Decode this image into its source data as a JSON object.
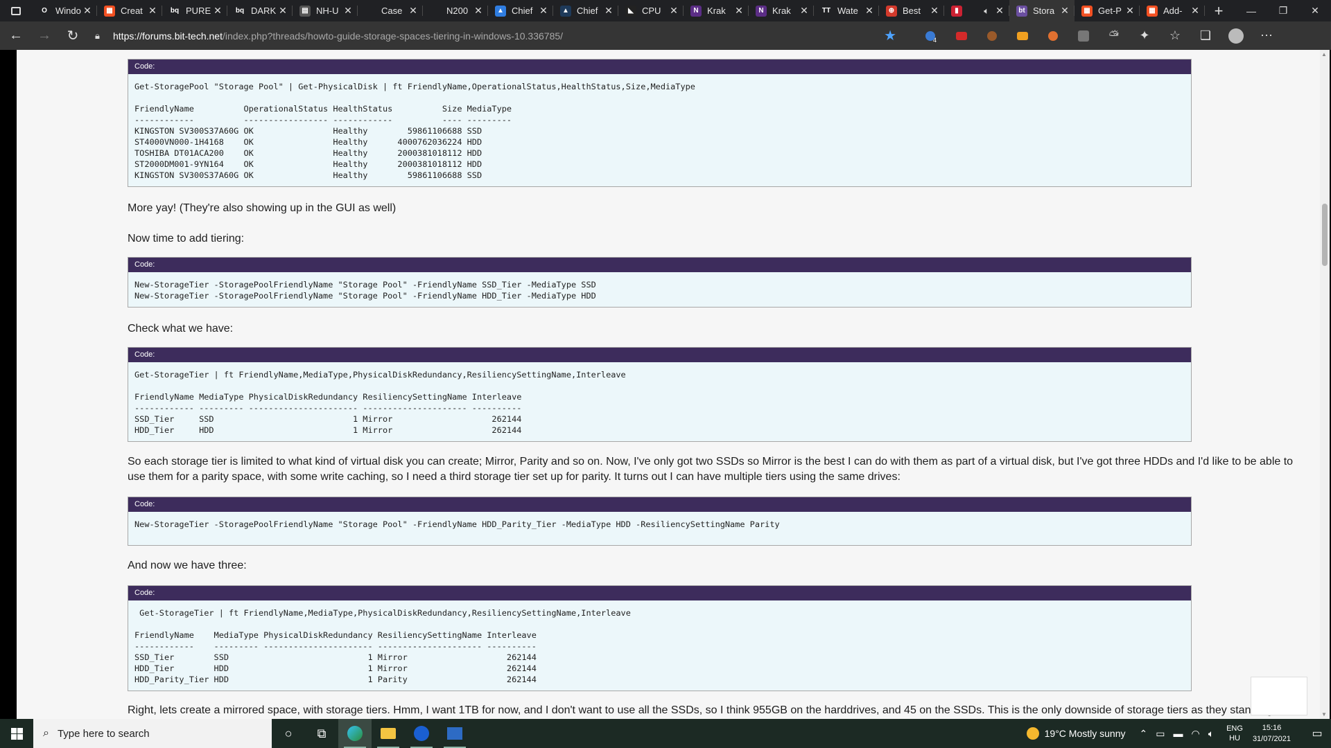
{
  "tabs": [
    {
      "title": "Windo",
      "color": "#202124",
      "glyph": "O"
    },
    {
      "title": "Creat",
      "color": "#f25022",
      "glyph": "▦"
    },
    {
      "title": "PURE",
      "color": "#202124",
      "glyph": "bq"
    },
    {
      "title": "DARK",
      "color": "#202124",
      "glyph": "bq"
    },
    {
      "title": "NH-U",
      "color": "#555555",
      "glyph": "▤"
    },
    {
      "title": "Case",
      "color": "#202124",
      "glyph": ""
    },
    {
      "title": "N200",
      "color": "#202124",
      "glyph": ""
    },
    {
      "title": "Chief",
      "color": "#2f7de1",
      "glyph": "▲"
    },
    {
      "title": "Chief",
      "color": "#1e3a5a",
      "glyph": "▲"
    },
    {
      "title": "CPU",
      "color": "#222222",
      "glyph": "◣"
    },
    {
      "title": "Krak",
      "color": "#5b2d86",
      "glyph": "N"
    },
    {
      "title": "Krak",
      "color": "#5b2d86",
      "glyph": "N"
    },
    {
      "title": "Wate",
      "color": "#202124",
      "glyph": "TT"
    },
    {
      "title": "Best",
      "color": "#d33a2c",
      "glyph": "⊕"
    },
    {
      "title": "",
      "color": "#c23",
      "glyph": "▮"
    },
    {
      "title": "Stora",
      "color": "#6b4fa0",
      "glyph": "bt"
    },
    {
      "title": "Get-P",
      "color": "#f25022",
      "glyph": "▦"
    },
    {
      "title": "Add-",
      "color": "#f25022",
      "glyph": "▦"
    }
  ],
  "nav": {
    "url_host": "https://forums.bit-tech.net",
    "url_path": "/index.php?threads/howto-guide-storage-spaces-tiering-in-windows-10.336785/",
    "ext_badge": "4"
  },
  "content": {
    "code_label": "Code:",
    "block1": "Get-StoragePool \"Storage Pool\" | Get-PhysicalDisk | ft FriendlyName,OperationalStatus,HealthStatus,Size,MediaType\n\nFriendlyName          OperationalStatus HealthStatus          Size MediaType\n------------          ----------------- ------------          ---- ---------\nKINGSTON SV300S37A60G OK                Healthy        59861106688 SSD\nST4000VN000-1H4168    OK                Healthy      4000762036224 HDD\nTOSHIBA DT01ACA200    OK                Healthy      2000381018112 HDD\nST2000DM001-9YN164    OK                Healthy      2000381018112 HDD\nKINGSTON SV300S37A60G OK                Healthy        59861106688 SSD",
    "p1": "More yay! (They're also showing up in the GUI as well)",
    "p2": "Now time to add tiering:",
    "block2": "New-StorageTier -StoragePoolFriendlyName \"Storage Pool\" -FriendlyName SSD_Tier -MediaType SSD\nNew-StorageTier -StoragePoolFriendlyName \"Storage Pool\" -FriendlyName HDD_Tier -MediaType HDD",
    "p3": "Check what we have:",
    "block3": "Get-StorageTier | ft FriendlyName,MediaType,PhysicalDiskRedundancy,ResiliencySettingName,Interleave\n\nFriendlyName MediaType PhysicalDiskRedundancy ResiliencySettingName Interleave\n------------ --------- ---------------------- --------------------- ----------\nSSD_Tier     SSD                            1 Mirror                    262144\nHDD_Tier     HDD                            1 Mirror                    262144",
    "p4": "So each storage tier is limited to what kind of virtual disk you can create; Mirror, Parity and so on. Now, I've only got two SSDs so Mirror is the best I can do with them as part of a virtual disk, but I've got three HDDs and I'd like to be able to use them for a parity space, with some write caching, so I need a third storage tier set up for parity. It turns out I can have multiple tiers using the same drives:",
    "block4": "New-StorageTier -StoragePoolFriendlyName \"Storage Pool\" -FriendlyName HDD_Parity_Tier -MediaType HDD -ResiliencySettingName Parity",
    "p5": "And now we have three:",
    "block5": " Get-StorageTier | ft FriendlyName,MediaType,PhysicalDiskRedundancy,ResiliencySettingName,Interleave\n\nFriendlyName    MediaType PhysicalDiskRedundancy ResiliencySettingName Interleave\n------------    --------- ---------------------- --------------------- ----------\nSSD_Tier        SSD                            1 Mirror                    262144\nHDD_Tier        HDD                            1 Mirror                    262144\nHDD_Parity_Tier HDD                            1 Parity                    262144",
    "p6": "Right, lets create a mirrored space, with storage tiers. Hmm, I want 1TB for now, and I don't want to use all the SSDs, so I think 955GB on the harddrives, and 45 on the SSDs. This is the only downside of storage tiers as they stand right"
  },
  "taskbar": {
    "search_placeholder": "Type here to search",
    "weather": "19°C  Mostly sunny",
    "lang_top": "ENG",
    "lang_bottom": "HU",
    "time": "15:16",
    "date": "31/07/2021"
  }
}
